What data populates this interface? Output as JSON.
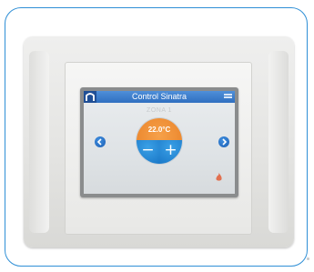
{
  "app": {
    "title": "Control Sinatra",
    "zone_label": "ZONA 1",
    "temperature": "22.0°C"
  },
  "controls": {
    "minus_label": "−",
    "plus_label": "+"
  },
  "icons": {
    "home": "home-icon",
    "menu": "menu-icon",
    "prev": "chevron-left-icon",
    "next": "chevron-right-icon",
    "heating": "flame-icon"
  },
  "pager": {
    "pages": 3,
    "active_index": 0
  },
  "device": {
    "brand": ""
  },
  "colors": {
    "titlebar": "#2f6fc0",
    "dial_top": "#ea842a",
    "dial_buttons": "#1a78c8",
    "card_border": "#2f8fd6",
    "flame": "#e2704f"
  }
}
